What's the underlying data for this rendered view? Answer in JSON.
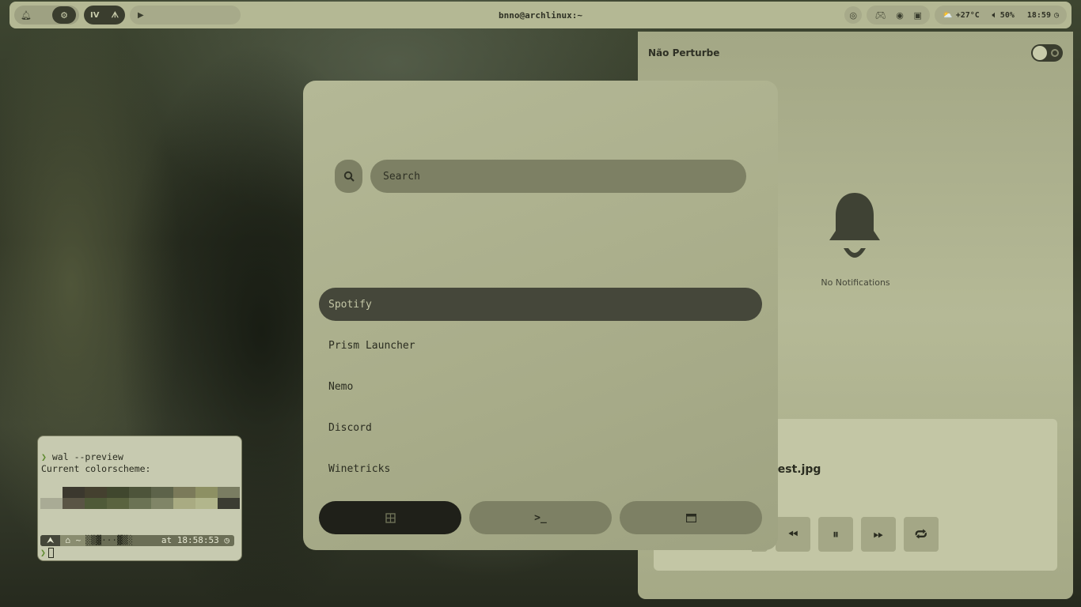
{
  "topbar": {
    "left_icons": [
      "bell-icon",
      "settings-icon"
    ],
    "workspace_label": "IV",
    "workspace_icon": "arch-icon",
    "media_icon": "play-icon",
    "window_title": "bnno@archlinux:~",
    "right": {
      "record_icon": "record-icon",
      "tray_icons": [
        "discord-icon",
        "steam-icon",
        "screenshot-icon"
      ],
      "weather_icon": "partly-cloudy-icon",
      "weather": "+27°C",
      "volume_icon": "volume-icon",
      "volume": "50%",
      "time": "18:59",
      "clock_icon": "clock-icon"
    }
  },
  "launcher": {
    "search_placeholder": "Search",
    "apps": [
      "Spotify",
      "Prism Launcher",
      "Nemo",
      "Discord",
      "Winetricks"
    ],
    "selected_index": 0,
    "tabs": [
      {
        "icon": "apps-grid-icon",
        "active": true
      },
      {
        "icon": "terminal-icon",
        "active": false
      },
      {
        "icon": "window-icon",
        "active": false
      }
    ]
  },
  "notifications": {
    "dnd_label": "Não Perturbe",
    "dnd_on": false,
    "empty_text": "No Notifications",
    "player": {
      "track": "y_forest.jpg",
      "controls": [
        "previous-icon",
        "pause-icon",
        "next-icon",
        "repeat-icon"
      ]
    }
  },
  "terminal": {
    "line1_prompt": "❯",
    "line1_cmd": "wal --preview",
    "line2": "Current colorscheme:",
    "swatch_row1": [
      "#c7cab0",
      "#3b382e",
      "#44402f",
      "#40472e",
      "#4d543a",
      "#5d634a",
      "#7b7a5a",
      "#8d9063",
      "#7a7d62"
    ],
    "swatch_row2": [
      "#a9ab95",
      "#5a5545",
      "#4f5a38",
      "#5a633f",
      "#6b7354",
      "#808567",
      "#a9ab82",
      "#b2b68c",
      "#3b3c32"
    ],
    "status_left": "⮝",
    "status_home": "⌂ ~",
    "status_mid": "░▒▓···▓▒░",
    "status_time": "at 18:58:53",
    "prompt2": "❯"
  },
  "colors": {
    "bar": "#b4b894",
    "launcher": "#aeb28f",
    "selected": "#45473a",
    "field": "#7d8064"
  }
}
